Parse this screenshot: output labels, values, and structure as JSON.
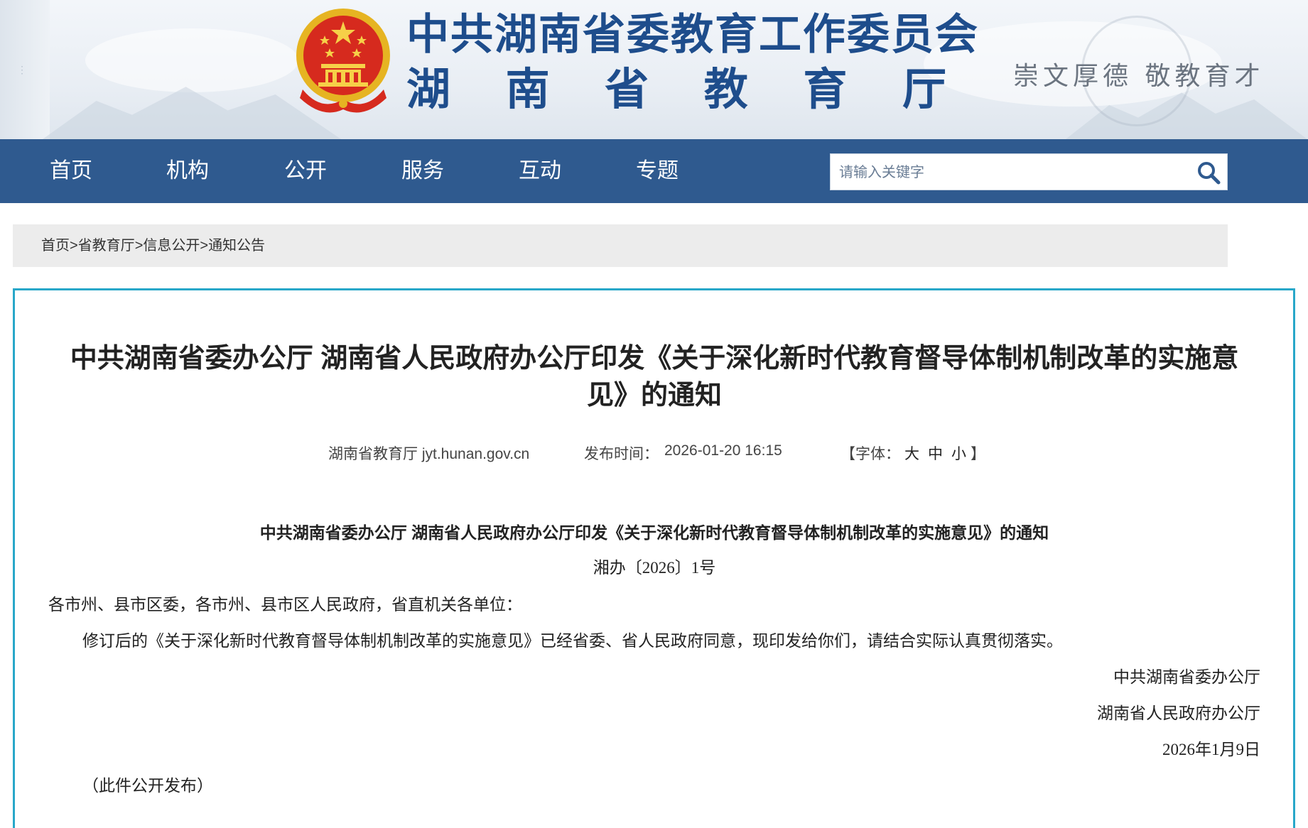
{
  "header": {
    "org_line1": "中共湖南省委教育工作委员会",
    "org_line2_chars": [
      "湖",
      "南",
      "省",
      "教",
      "育",
      "厅"
    ],
    "motto": "崇文厚德   敬教育才"
  },
  "nav": {
    "items": [
      "首页",
      "机构",
      "公开",
      "服务",
      "互动",
      "专题"
    ],
    "search_placeholder": "请输入关键字"
  },
  "breadcrumb": {
    "items": [
      "首页",
      "省教育厅",
      "信息公开",
      "通知公告"
    ],
    "separator": ">"
  },
  "article": {
    "title": "中共湖南省委办公厅 湖南省人民政府办公厅印发《关于深化新时代教育督导体制机制改革的实施意见》的通知",
    "source": "湖南省教育厅 jyt.hunan.gov.cn",
    "publish_label": "发布时间：",
    "publish_time": "2026-01-20 16:15",
    "font_size_open": "【字体：",
    "font_sizes": [
      "大",
      "中",
      "小"
    ],
    "font_size_close": "】",
    "doc_heading": "中共湖南省委办公厅  湖南省人民政府办公厅印发《关于深化新时代教育督导体制机制改革的实施意见》的通知",
    "doc_number": "湘办〔2026〕1号",
    "salutation": "各市州、县市区委，各市州、县市区人民政府，省直机关各单位：",
    "body": "修订后的《关于深化新时代教育督导体制机制改革的实施意见》已经省委、省人民政府同意，现印发给你们，请结合实际认真贯彻落实。",
    "signer1": "中共湖南省委办公厅",
    "signer2": "湖南省人民政府办公厅",
    "date": "2026年1月9日",
    "note": "（此件公开发布）"
  },
  "colors": {
    "nav_bg": "#2f5a8f",
    "title_blue": "#1e4d8c",
    "article_border": "#28a7c9",
    "breadcrumb_bg": "#ececec"
  }
}
